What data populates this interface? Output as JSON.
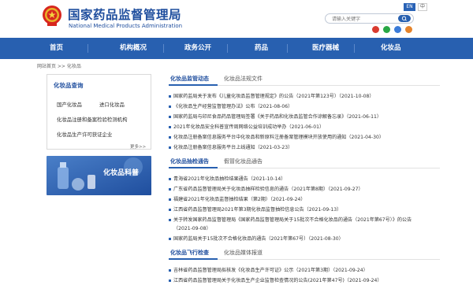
{
  "header": {
    "title_cn": "国家药品监督管理局",
    "title_en": "National Medical Products Administration",
    "lang_en": "EN",
    "lang_cn": "中",
    "search_placeholder": "请输入关键字"
  },
  "nav": [
    "首页",
    "机构概况",
    "政务公开",
    "药品",
    "医疗器械",
    "化妆品"
  ],
  "breadcrumb": "网站首页 >> 化妆品",
  "sidebar": {
    "title": "化妆品查询",
    "links": [
      "国产化妆品",
      "进口化妆品",
      "化妆品注册和备案检验检测机构",
      "化妆品生产许可获证企业"
    ],
    "more": "更多>>",
    "science_label": "化妆品科普"
  },
  "sections": [
    {
      "tabs": [
        "化妆品监管动态",
        "化妆品法规文件"
      ],
      "items": [
        "国家药监局关于发布《儿童化妆品监督管理规定》的公告（2021年第123号）（2021-10-08）",
        "《化妆品生产经营监督管理办法》公布（2021-08-06）",
        "国家药监局与印尼食品药品管理局签署《关于药品和化妆品监管合作谅解备忘录》（2021-06-11）",
        "2021年化妆品安全科普宣传周网络公益培训成功举办（2021-06-01）",
        "化妆品注册备案信息服务平台中化妆品和新原料注册备案管理模块开放使用的通知（2021-04-30）",
        "化妆品注册备案信息服务平台上线通知（2021-03-23）"
      ]
    },
    {
      "tabs": [
        "化妆品抽检通告",
        "假冒化妆品通告"
      ],
      "items": [
        "青海省2021年化妆品抽检结果通告（2021-10-14）",
        "广东省药品监督管理局关于化妆品抽样检验信息的通告（2021年第8期）（2021-09-27）",
        "福建省2021年化妆品监督抽检结果（第2期）（2021-09-24）",
        "江西省药品监督管理局2021年第3期化妆品监督抽检信息公告（2021-09-13）",
        "关于转发国家药品监督管理局《国家药品监督管理局关于15批次不合格化妆品的通告（2021年第67号）》的公告",
        "（2021-09-08）",
        "国家药监局关于15批次不合格化妆品的通告（2021年第67号）（2021-08-30）"
      ]
    },
    {
      "tabs": [
        "化妆品飞行检查",
        "化妆品媒体报道"
      ],
      "items": [
        "吉林省药品监督管理局拟核发《化妆品生产许可证》公示（2021年第3期）（2021-09-24）",
        "江西省药品监督管理局关于化妆品生产企业监督检查情况的公告(2021年第47号)（2021-09-24）"
      ]
    }
  ],
  "colors": {
    "brand": "#2860b0",
    "title": "#1f4e9e"
  }
}
